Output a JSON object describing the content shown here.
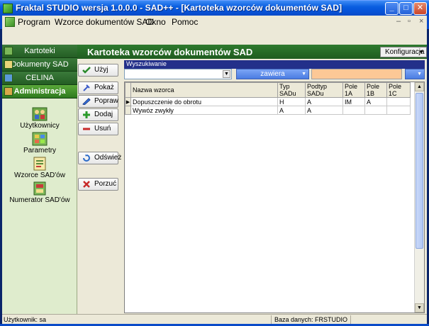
{
  "window": {
    "title": "Fraktal STUDIO   wersja 1.0.0.0 - SAD++ - [Kartoteka wzorców dokumentów SAD]",
    "min_glyph": "_",
    "max_glyph": "□",
    "close_glyph": "✕"
  },
  "menu": {
    "items": [
      "Program",
      "Wzorce dokumentów SAD",
      "Okno",
      "Pomoc"
    ],
    "mdi": [
      "–",
      "▫",
      "×"
    ]
  },
  "nav": {
    "sections": [
      "Kartoteki",
      "Dokumenty SAD",
      "CELINA",
      "Administracja"
    ],
    "active": "Administracja",
    "tools": [
      "Użytkownicy",
      "Parametry",
      "Wzorce SAD'ów",
      "Numerator SAD'ów"
    ]
  },
  "header": {
    "title": "Kartoteka wzorców dokumentów SAD",
    "config_label": "Konfiguracja"
  },
  "actions": {
    "uzyj": "Użyj",
    "pokaz": "Pokaż",
    "popraw": "Popraw",
    "dodaj": "Dodaj",
    "usun": "Usuń",
    "odswiez": "Odśwież",
    "porzuc": "Porzuć"
  },
  "search": {
    "label": "Wyszukiwanie",
    "field_value": "",
    "operator": "zawiera",
    "value": ""
  },
  "grid": {
    "columns": [
      "Nazwa wzorca",
      "Typ SADu",
      "Podtyp SADu",
      "Pole 1A",
      "Pole 1B",
      "Pole 1C"
    ],
    "rows": [
      [
        "Dopuszczenie do obrotu",
        "H",
        "A",
        "IM",
        "A",
        ""
      ],
      [
        "Wywóz zwykły",
        "A",
        "A",
        "",
        "",
        ""
      ]
    ]
  },
  "status": {
    "user": "Użytkownik: sa",
    "database": "Baza danych: FRSTUDIO"
  },
  "colors": {
    "nav_bg": "#dfeccd",
    "header_green": "#1f5c1f",
    "search_value_bg": "#fcc896",
    "title_blue": "#0653d8"
  }
}
